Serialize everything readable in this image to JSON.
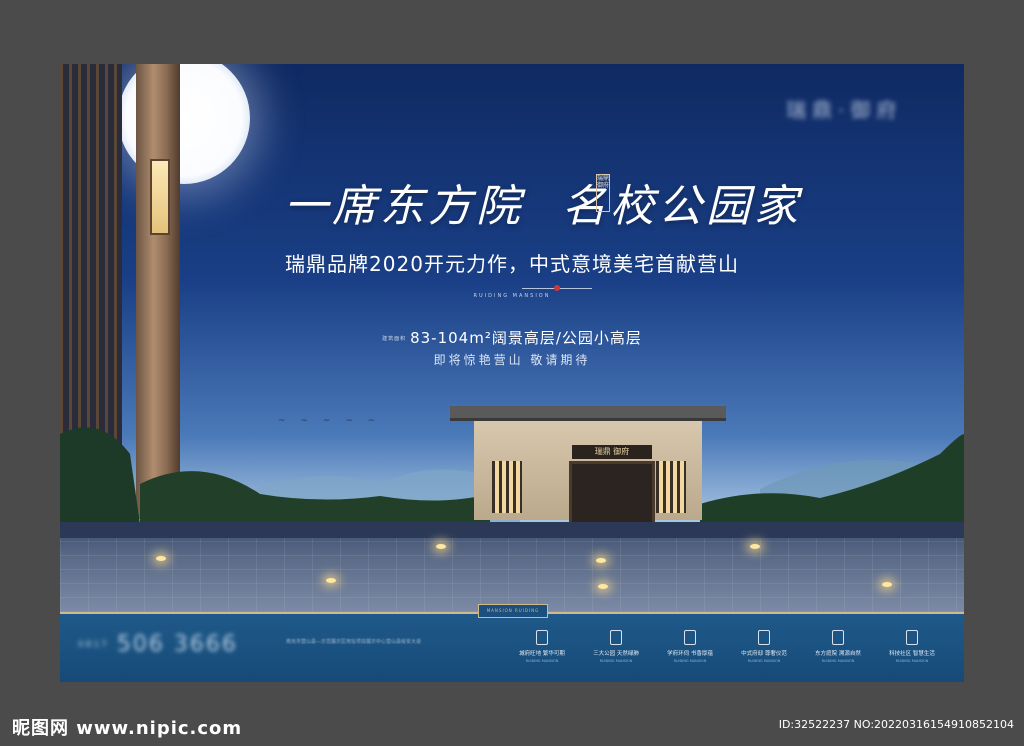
{
  "poster": {
    "logo": "瑞鼎·御府",
    "headline_part1": "一席东方院",
    "headline_part2": "名校公园家",
    "seal_text": "瑞鼎御府",
    "subline": "瑞鼎品牌2020开元力作，中式意境美宅首献营山",
    "divider_text": "RUIDING MANSION",
    "area_prefix": "建筑面积",
    "area_text": "83-104m²阔景高层/公园小高层",
    "coming_text": "即将惊艳营山 敬请期待",
    "gate_plaque": "瑞鼎 御府",
    "bottom_badge": "MANSION RUIDING"
  },
  "contact": {
    "phone_prefix": "0817",
    "phone": "506 3666",
    "address": "南充市营山县—示范展示区地址项目展示中心营山县绥安大道"
  },
  "features": [
    {
      "label": "城府旺地 繁华可期",
      "en": "RUIDING MANSION"
    },
    {
      "label": "三大公园 天然绿肺",
      "en": "RUIDING MANSION"
    },
    {
      "label": "学府环伺 书香厚蕴",
      "en": "RUIDING MANSION"
    },
    {
      "label": "中式府邸 尊奢仪范",
      "en": "RUIDING MANSION"
    },
    {
      "label": "东方庭院 溯源自然",
      "en": "RUIDING MANSION"
    },
    {
      "label": "科技社区 智慧生活",
      "en": "RUIDING MANSION"
    }
  ],
  "footer": {
    "site": "昵图网 www.nipic.com",
    "id_text": "ID:32522237 NO:20220316154910852104"
  }
}
